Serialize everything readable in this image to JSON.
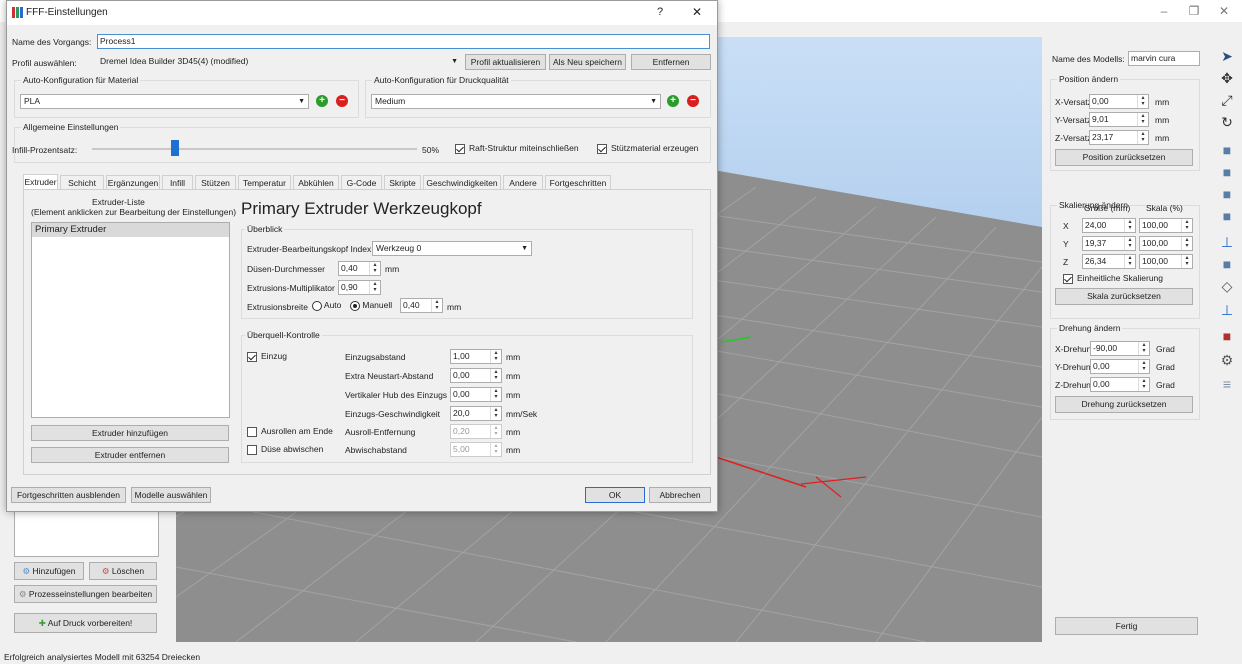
{
  "main": {
    "window_buttons": {
      "minimize": "–",
      "maximize": "❐",
      "close": "✕"
    },
    "status": "Erfolgreich analysiertes Modell mit 63254 Dreiecken",
    "left": {
      "add_btn": "Hinzufügen",
      "delete_btn": "Löschen",
      "edit_process_btn": "Prozesseinstellungen bearbeiten",
      "prepare_btn": "Auf Druck vorbereiten!"
    },
    "right": {
      "model_name_label": "Name des Modells:",
      "model_name_value": "marvin cura",
      "position_title": "Position ändern",
      "x_offset_label": "X-Versatz",
      "x_offset": "0,00",
      "y_offset_label": "Y-Versatz",
      "y_offset": "9,01",
      "z_offset_label": "Z-Versatz",
      "z_offset": "23,17",
      "mm": "mm",
      "reset_position": "Position zurücksetzen",
      "scale_title": "Skalierung ändern",
      "size_header": "Größe (mm)",
      "scale_header": "Skala (%)",
      "x": "X",
      "y": "Y",
      "z": "Z",
      "size_x": "24,00",
      "size_y": "19,37",
      "size_z": "26,34",
      "scale_x": "100,00",
      "scale_y": "100,00",
      "scale_z": "100,00",
      "uniform_label": "Einheitliche Skalierung",
      "reset_scale": "Skala zurücksetzen",
      "rotation_title": "Drehung ändern",
      "x_rot_label": "X-Drehung",
      "x_rot": "-90,00",
      "y_rot_label": "Y-Drehung",
      "y_rot": "0,00",
      "z_rot_label": "Z-Drehung",
      "z_rot": "0,00",
      "grad": "Grad",
      "reset_rotation": "Drehung zurücksetzen",
      "done_btn": "Fertig"
    },
    "tools": [
      "cursor-icon",
      "move-icon",
      "scale-icon",
      "rotate-icon",
      "cube-front-icon",
      "cube-side-icon",
      "cube-top-icon",
      "cube-iso-icon",
      "axes-icon",
      "cube-solid-icon",
      "cube-wire-icon",
      "anchor-icon",
      "cube-red-icon",
      "gear-icon",
      "layers-icon"
    ]
  },
  "dialog": {
    "title": "FFF-Einstellungen",
    "help": "?",
    "close": "✕",
    "process_name_label": "Name des Vorgangs:",
    "process_name": "Process1",
    "profile_label": "Profil auswählen:",
    "profile_value": "Dremel Idea Builder 3D45(4) (modified)",
    "update_profile_btn": "Profil aktualisieren",
    "save_new_btn": "Als Neu speichern",
    "remove_btn": "Entfernen",
    "material_group": "Auto-Konfiguration für Material",
    "material_value": "PLA",
    "quality_group": "Auto-Konfiguration für Druckqualität",
    "quality_value": "Medium",
    "general_group": "Allgemeine Einstellungen",
    "infill_label": "Infill-Prozentsatz:",
    "infill_percent": "50%",
    "infill_fraction": 0.5,
    "raft_label": "Raft-Struktur miteinschließen",
    "support_label": "Stützmaterial erzeugen",
    "tabs": [
      "Extruder",
      "Schicht",
      "Ergänzungen",
      "Infill",
      "Stützen",
      "Temperatur",
      "Abkühlen",
      "G-Code",
      "Skripte",
      "Geschwindigkeiten",
      "Andere",
      "Fortgeschritten"
    ],
    "extruder_list_title_1": "Extruder-Liste",
    "extruder_list_title_2": "(Element anklicken zur Bearbeitung der Einstellungen)",
    "extruder_item": "Primary Extruder",
    "add_extruder_btn": "Extruder hinzufügen",
    "remove_extruder_btn": "Extruder entfernen",
    "heading": "Primary Extruder Werkzeugkopf",
    "overview_group": "Überblick",
    "toolhead_index_label": "Extruder-Bearbeitungskopf Index",
    "toolhead_index_value": "Werkzeug 0",
    "nozzle_label": "Düsen-Durchmesser",
    "nozzle_value": "0,40",
    "multiplier_label": "Extrusions-Multiplikator",
    "multiplier_value": "0,90",
    "width_label": "Extrusionsbreite",
    "auto_label": "Auto",
    "manual_label": "Manuell",
    "width_value": "0,40",
    "mm": "mm",
    "ooze_group": "Überquell-Kontrolle",
    "retraction_label": "Einzug",
    "retraction_distance_label": "Einzugsabstand",
    "retraction_distance": "1,00",
    "extra_restart_label": "Extra Neustart-Abstand",
    "extra_restart": "0,00",
    "vertical_lift_label": "Vertikaler Hub des Einzugs",
    "vertical_lift": "0,00",
    "retraction_speed_label": "Einzugs-Geschwindigkeit",
    "retraction_speed": "20,0",
    "mm_sec": "mm/Sek",
    "coast_label": "Ausrollen am Ende",
    "coast_distance_label": "Ausroll-Entfernung",
    "coast_distance": "0,20",
    "wipe_label": "Düse abwischen",
    "wipe_distance_label": "Abwischabstand",
    "wipe_distance": "5,00",
    "hide_advanced_btn": "Fortgeschritten ausblenden",
    "select_models_btn": "Modelle auswählen",
    "ok_btn": "OK",
    "cancel_btn": "Abbrechen"
  }
}
